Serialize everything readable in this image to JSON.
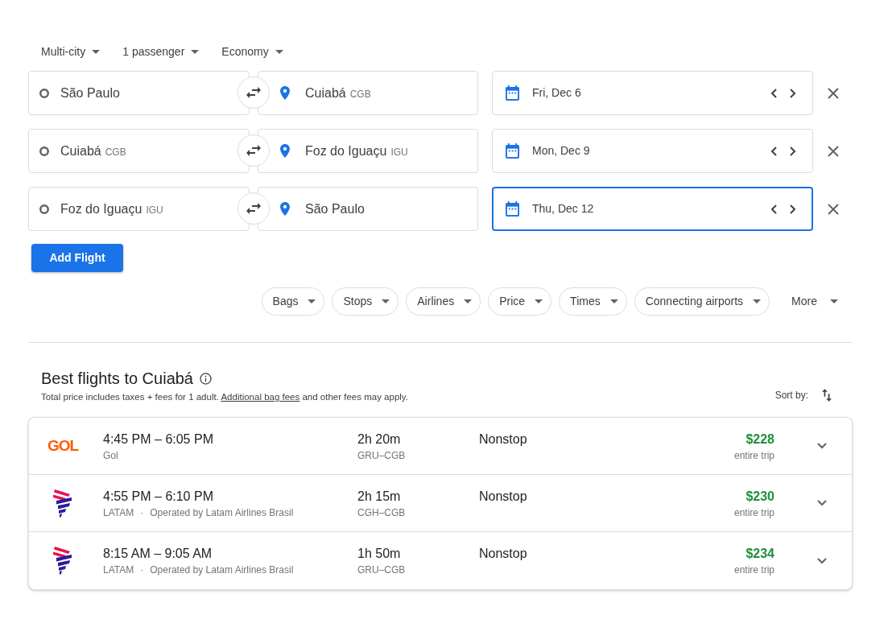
{
  "trip_options": [
    {
      "label": "Multi-city"
    },
    {
      "label": "1 passenger"
    },
    {
      "label": "Economy"
    }
  ],
  "legs": [
    {
      "origin": "São Paulo",
      "destination": "Cuiabá",
      "destination_code": "CGB",
      "date": "Fri, Dec 6",
      "focused": false
    },
    {
      "origin": "Cuiabá",
      "origin_code": "CGB",
      "destination": "Foz do Iguaçu",
      "destination_code": "IGU",
      "date": "Mon, Dec 9",
      "focused": false
    },
    {
      "origin": "Foz do Iguaçu",
      "origin_code": "IGU",
      "destination": "São Paulo",
      "date": "Thu, Dec 12",
      "focused": true
    }
  ],
  "add_flight_button": "Add Flight",
  "filters": [
    {
      "label": "Bags",
      "kind": "chip"
    },
    {
      "label": "Stops",
      "kind": "chip"
    },
    {
      "label": "Airlines",
      "kind": "chip"
    },
    {
      "label": "Price",
      "kind": "chip"
    },
    {
      "label": "Times",
      "kind": "chip"
    },
    {
      "label": "Connecting airports",
      "kind": "chip"
    },
    {
      "label": "More",
      "kind": "plain"
    }
  ],
  "results": {
    "title": "Best flights to Cuiabá",
    "note": {
      "before": "Total price includes taxes + fees for 1 adult.",
      "link": "Additional bag fees",
      "after": "and other fees may apply."
    },
    "sort_label": "Sort by:",
    "flights": [
      {
        "logo": {
          "kind": "wordmark",
          "text": "GOL"
        },
        "times": "4:45 PM – 6:05 PM",
        "airline": "Gol",
        "duration": "2h 20m",
        "route": "GRU–CGB",
        "stops": "Nonstop",
        "price": "$228",
        "price_note": "entire trip",
        "expanded": false
      },
      {
        "logo": {
          "kind": "stripes"
        },
        "times": "4:55 PM – 6:10 PM",
        "airline": "LATAM",
        "separator": "·",
        "operated_by": "Operated by Latam Airlines Brasil",
        "duration": "2h 15m",
        "route": "CGH–CGB",
        "stops": "Nonstop",
        "price": "$230",
        "price_note": "entire trip",
        "expanded": false
      },
      {
        "logo": {
          "kind": "stripes"
        },
        "times": "8:15 AM – 9:05 AM",
        "airline": "LATAM",
        "separator": "·",
        "operated_by": "Operated by Latam Airlines Brasil",
        "duration": "1h 50m",
        "route": "GRU–CGB",
        "stops": "Nonstop",
        "price": "$234",
        "price_note": "entire trip",
        "expanded": false
      }
    ]
  }
}
